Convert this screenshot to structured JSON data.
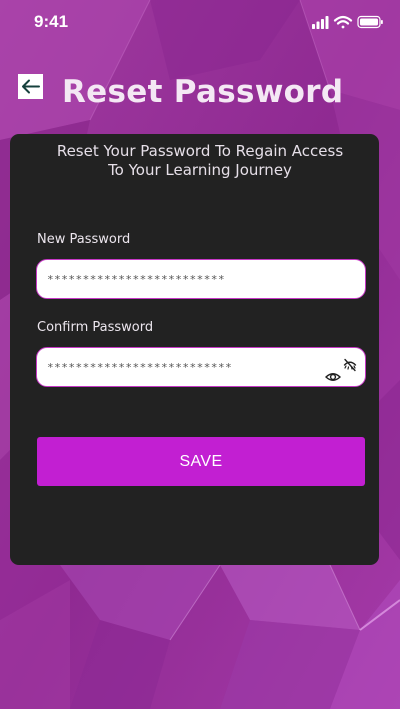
{
  "status_bar": {
    "time": "9:41",
    "icons": [
      "signal-icon",
      "wifi-icon",
      "battery-icon"
    ]
  },
  "header": {
    "back_icon": "arrow-left-icon",
    "title": "Reset Password"
  },
  "card": {
    "subtitle": "Reset Your Password To Regain Access\nTo Your Learning Journey",
    "new_password": {
      "label": "New Password",
      "value": "*************************"
    },
    "confirm_password": {
      "label": "Confirm Password",
      "value": "**************************",
      "icons": [
        "eye-off-icon",
        "eye-icon"
      ]
    },
    "save_label": "SAVE"
  },
  "colors": {
    "background": "#9a2f96",
    "card": "#222222",
    "accent": "#c21fd2",
    "input_border": "#c638c6",
    "title_text": "#f4e8f4"
  }
}
